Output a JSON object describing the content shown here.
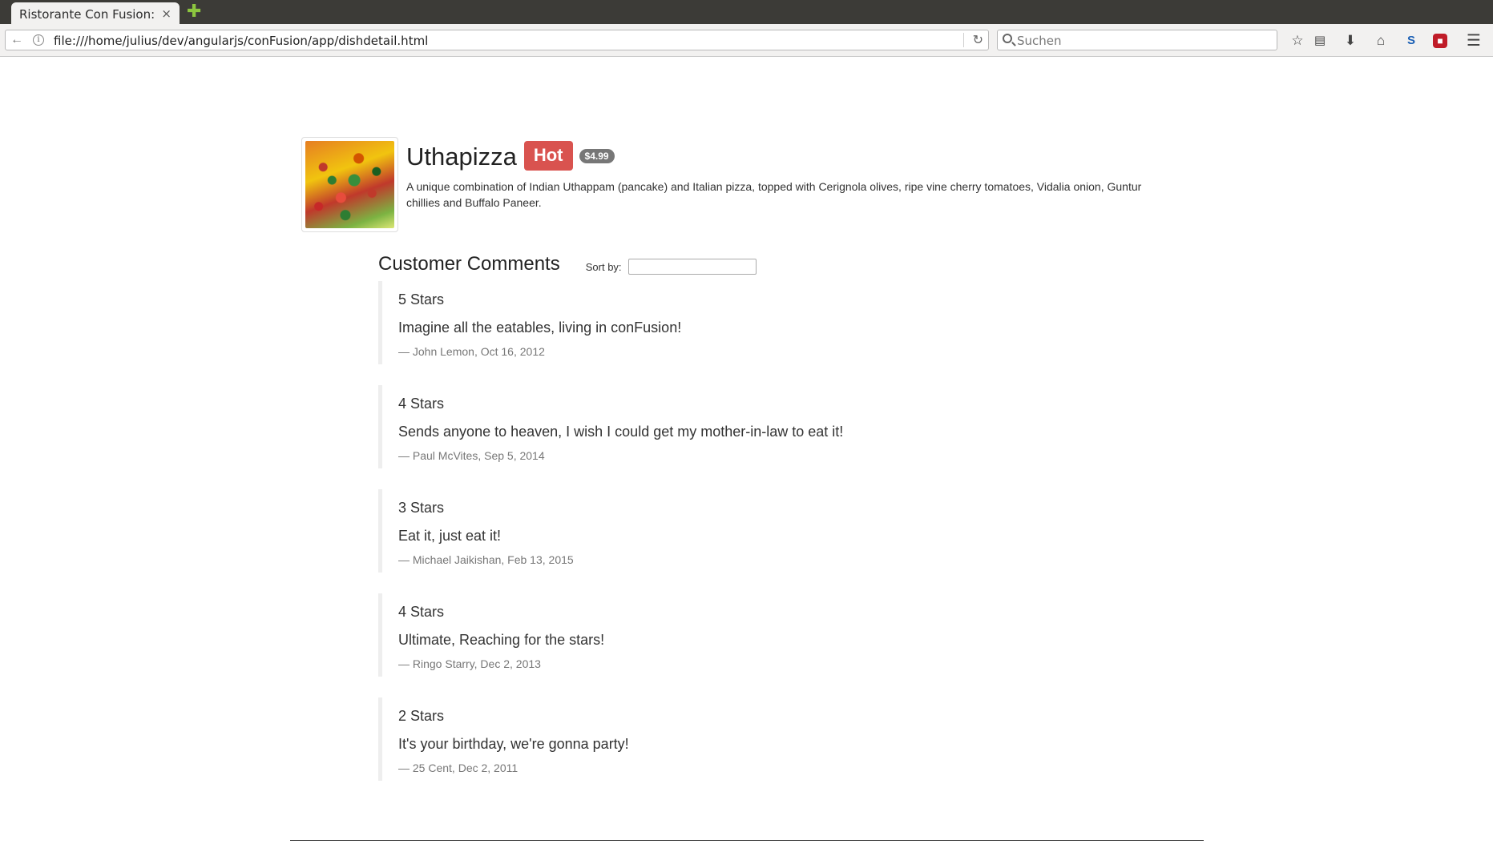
{
  "browser": {
    "tab_title": "Ristorante Con Fusion: ...",
    "tab_close": "×",
    "new_tab": "✚",
    "url": "file:///home/julius/dev/angularjs/conFusion/app/dishdetail.html",
    "search_placeholder": "Suchen",
    "toolbar_icons": [
      "back-icon",
      "info-icon",
      "reload-icon",
      "search-icon",
      "bookmark-star-icon",
      "reader-icon",
      "download-icon",
      "home-icon",
      "sync-icon",
      "extension-icon",
      "menu-icon"
    ]
  },
  "dish": {
    "name": "Uthapizza",
    "label": "Hot",
    "price": "$4.99",
    "description": "A unique combination of Indian Uthappam (pancake) and Italian pizza, topped with Cerignola olives, ripe vine cherry tomatoes, Vidalia onion, Guntur chillies and Buffalo Paneer."
  },
  "comments_section": {
    "title": "Customer Comments",
    "sort_label": "Sort by:",
    "sort_value": ""
  },
  "comments": [
    {
      "stars": "5 Stars",
      "text": "Imagine all the eatables, living in conFusion!",
      "footer": "— John Lemon, Oct 16, 2012"
    },
    {
      "stars": "4 Stars",
      "text": "Sends anyone to heaven, I wish I could get my mother-in-law to eat it!",
      "footer": "— Paul McVites, Sep 5, 2014"
    },
    {
      "stars": "3 Stars",
      "text": "Eat it, just eat it!",
      "footer": "— Michael Jaikishan, Feb 13, 2015"
    },
    {
      "stars": "4 Stars",
      "text": "Ultimate, Reaching for the stars!",
      "footer": "— Ringo Starry, Dec 2, 2013"
    },
    {
      "stars": "2 Stars",
      "text": "It's your birthday, we're gonna party!",
      "footer": "— 25 Cent, Dec 2, 2011"
    }
  ],
  "colors": {
    "hot_label": "#d9534f",
    "price_badge": "#777777",
    "blockquote_border": "#eeeeee"
  }
}
